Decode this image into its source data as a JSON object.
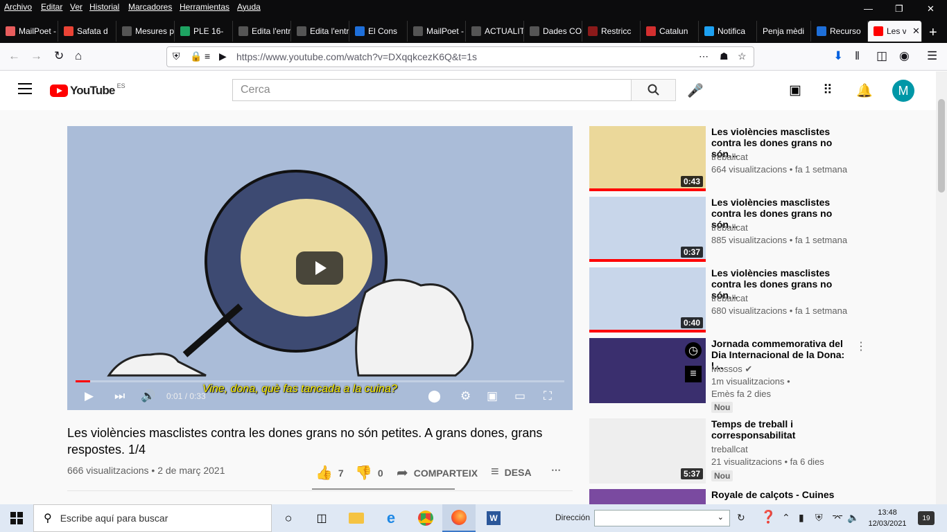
{
  "menu": [
    "Archivo",
    "Editar",
    "Ver",
    "Historial",
    "Marcadores",
    "Herramientas",
    "Ayuda"
  ],
  "tabs": [
    {
      "label": "MailPoet - E",
      "color": "#e85d5d"
    },
    {
      "label": "Safata d",
      "color": "#ea4335"
    },
    {
      "label": "Mesures pe",
      "color": "#555555"
    },
    {
      "label": "PLE 16-",
      "color": "#1ea362"
    },
    {
      "label": "Edita l'entra",
      "color": "#555555"
    },
    {
      "label": "Edita l'entra",
      "color": "#555555"
    },
    {
      "label": "El Cons",
      "color": "#1e6fd9"
    },
    {
      "label": "MailPoet - (",
      "color": "#555555"
    },
    {
      "label": "ACTUALITA",
      "color": "#555555"
    },
    {
      "label": "Dades COVI",
      "color": "#555555"
    },
    {
      "label": "Restricc",
      "color": "#8b1a1a"
    },
    {
      "label": "Catalun",
      "color": "#d32f2f"
    },
    {
      "label": "Notifica",
      "color": "#1da1f2"
    },
    {
      "label": "Penja mèdi",
      "color": "#555555"
    },
    {
      "label": "Recurso",
      "color": "#1e6fd9"
    },
    {
      "label": "Les v",
      "color": "#ff0000"
    }
  ],
  "url": "https://www.youtube.com/watch?v=DXqqkcezK6Q&t=1s",
  "yt": {
    "logo_text": "YouTube",
    "logo_region": "ES",
    "search_placeholder": "Cerca",
    "avatar_letter": "M"
  },
  "video": {
    "caption": "Vine, dona, què fas tancada a la cuina?",
    "time": "0:01 / 0:33",
    "progress": 0.03,
    "title": "Les violències masclistes contra les dones grans no són petites. A grans dones, grans respostes. 1/4",
    "views": "666 visualitzacions",
    "date": "2 de març 2021",
    "likes": "7",
    "dislikes": "0",
    "share": "COMPARTEIX",
    "save": "DESA"
  },
  "recs": [
    {
      "title": "Les violències masclistes contra les dones grans no són…",
      "channel": "treballcat",
      "meta": "664 visualitzacions • fa 1 setmana",
      "duration": "0:43",
      "bg": "#ebd89a"
    },
    {
      "title": "Les violències masclistes contra les dones grans no són…",
      "channel": "treballcat",
      "meta": "885 visualitzacions • fa 1 setmana",
      "duration": "0:37",
      "bg": "#c8d6ea"
    },
    {
      "title": "Les violències masclistes contra les dones grans no són…",
      "channel": "treballcat",
      "meta": "680 visualitzacions • fa 1 setmana",
      "duration": "0:40",
      "bg": "#c8d6ea"
    },
    {
      "title": "Jornada commemorativa del Dia Internacional de la Dona: l…",
      "channel": "Mossos",
      "meta": "1m visualitzacions •",
      "meta2": "Emès fa 2 dies",
      "badge": "Nou",
      "bg": "#3a2f6e"
    },
    {
      "title": "Temps de treball i corresponsabilitat",
      "channel": "treballcat",
      "meta": "21 visualitzacions • fa 6 dies",
      "duration": "5:37",
      "badge": "Nou",
      "bg": "#eeeeee"
    },
    {
      "title": "Royale de calçots - Cuines",
      "bg": "#7a4aa0"
    }
  ],
  "taskbar": {
    "search_placeholder": "Escribe aquí para buscar",
    "dir_label": "Dirección",
    "time": "13:48",
    "date": "12/03/2021",
    "notifications": "19"
  }
}
